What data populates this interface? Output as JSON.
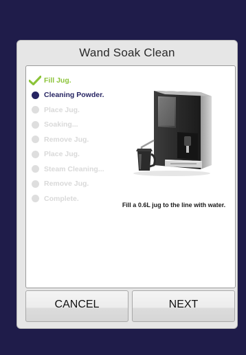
{
  "dialog": {
    "title": "Wand Soak Clean"
  },
  "steps": [
    {
      "label": "Fill Jug.",
      "state": "done"
    },
    {
      "label": "Cleaning Powder.",
      "state": "active"
    },
    {
      "label": "Place Jug.",
      "state": "pending"
    },
    {
      "label": "Soaking...",
      "state": "pending"
    },
    {
      "label": "Remove Jug.",
      "state": "pending"
    },
    {
      "label": "Place Jug.",
      "state": "pending"
    },
    {
      "label": "Steam Cleaning...",
      "state": "pending"
    },
    {
      "label": "Remove Jug.",
      "state": "pending"
    },
    {
      "label": "Complete.",
      "state": "pending"
    }
  ],
  "instruction": "Fill a 0.6L jug to the line with water.",
  "buttons": {
    "cancel": "CANCEL",
    "next": "NEXT"
  },
  "colors": {
    "background": "#1f1c4a",
    "done": "#8cc43a",
    "active": "#262462",
    "pending": "#dedede"
  },
  "icons": {
    "done": "check-icon",
    "active": "filled-dot-icon",
    "pending": "grey-dot-icon"
  }
}
